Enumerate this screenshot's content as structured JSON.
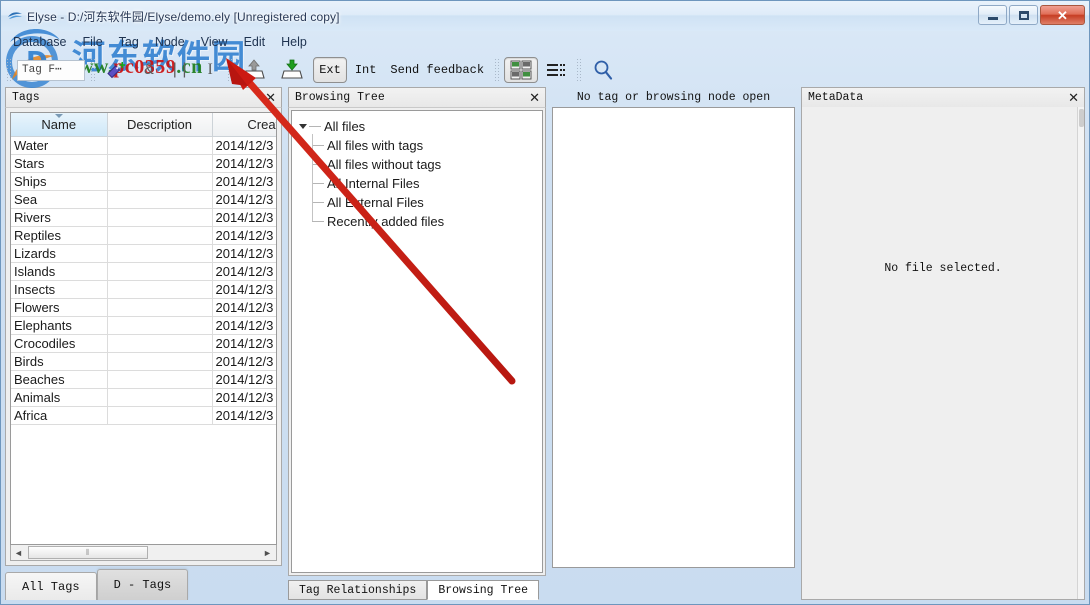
{
  "window": {
    "title": "Elyse - D:/河东软件园/Elyse/demo.ely [Unregistered copy]",
    "minimize_label": "–",
    "maximize_label": "□",
    "close_label": "✕"
  },
  "menubar": {
    "items": [
      {
        "label": "Database"
      },
      {
        "label": "File"
      },
      {
        "label": "Tag"
      },
      {
        "label": "Node"
      },
      {
        "label": "View"
      },
      {
        "label": "Edit"
      },
      {
        "label": "Help"
      }
    ]
  },
  "toolbar": {
    "tag_filter_value": "Tag F⋯",
    "tag_filter_placeholder": "Tag Filter",
    "and_label": "&",
    "or_label": "||",
    "not_label": "I",
    "ext_label": "Ext",
    "int_label": "Int",
    "feedback_label": "Send feedback"
  },
  "tags_panel": {
    "title": "Tags",
    "close_label": "✕",
    "columns": [
      "Name",
      "Description",
      "Creation"
    ],
    "rows": [
      {
        "name": "Water",
        "description": "",
        "creation": "2014/12/3"
      },
      {
        "name": "Stars",
        "description": "",
        "creation": "2014/12/3"
      },
      {
        "name": "Ships",
        "description": "",
        "creation": "2014/12/3"
      },
      {
        "name": "Sea",
        "description": "",
        "creation": "2014/12/3"
      },
      {
        "name": "Rivers",
        "description": "",
        "creation": "2014/12/3"
      },
      {
        "name": "Reptiles",
        "description": "",
        "creation": "2014/12/3"
      },
      {
        "name": "Lizards",
        "description": "",
        "creation": "2014/12/3"
      },
      {
        "name": "Islands",
        "description": "",
        "creation": "2014/12/3"
      },
      {
        "name": "Insects",
        "description": "",
        "creation": "2014/12/3"
      },
      {
        "name": "Flowers",
        "description": "",
        "creation": "2014/12/3"
      },
      {
        "name": "Elephants",
        "description": "",
        "creation": "2014/12/3"
      },
      {
        "name": "Crocodiles",
        "description": "",
        "creation": "2014/12/3"
      },
      {
        "name": "Birds",
        "description": "",
        "creation": "2014/12/3"
      },
      {
        "name": "Beaches",
        "description": "",
        "creation": "2014/12/3"
      },
      {
        "name": "Animals",
        "description": "",
        "creation": "2014/12/3"
      },
      {
        "name": "Africa",
        "description": "",
        "creation": "2014/12/3"
      }
    ],
    "scroll_left_label": "◄",
    "scroll_right_label": "►",
    "tabs": [
      {
        "label": "All Tags",
        "active": false
      },
      {
        "label": "D - Tags",
        "active": true
      }
    ]
  },
  "tree_panel": {
    "title": "Browsing Tree",
    "close_label": "✕",
    "root": "All files",
    "children": [
      {
        "label": "All files with tags"
      },
      {
        "label": "All files without tags"
      },
      {
        "label": "All Internal Files"
      },
      {
        "label": "All External Files"
      },
      {
        "label": "Recently added files"
      }
    ],
    "tabs": [
      {
        "label": "Tag Relationships",
        "active": false
      },
      {
        "label": "Browsing Tree",
        "active": true
      }
    ]
  },
  "center_panel": {
    "caption": "No tag or browsing node open"
  },
  "metadata_panel": {
    "title": "MetaData",
    "close_label": "✕",
    "empty_text": "No file selected."
  },
  "watermark": {
    "chinese": "河东软件园",
    "url_prefix": "www.",
    "url_mid": "pc0359",
    "url_suffix": ".cn"
  },
  "colors": {
    "accent": "#2f7fd0",
    "close_red": "#c63d23",
    "arrow_red": "#cc1a12",
    "sorted_header": "#cfe8f8"
  }
}
